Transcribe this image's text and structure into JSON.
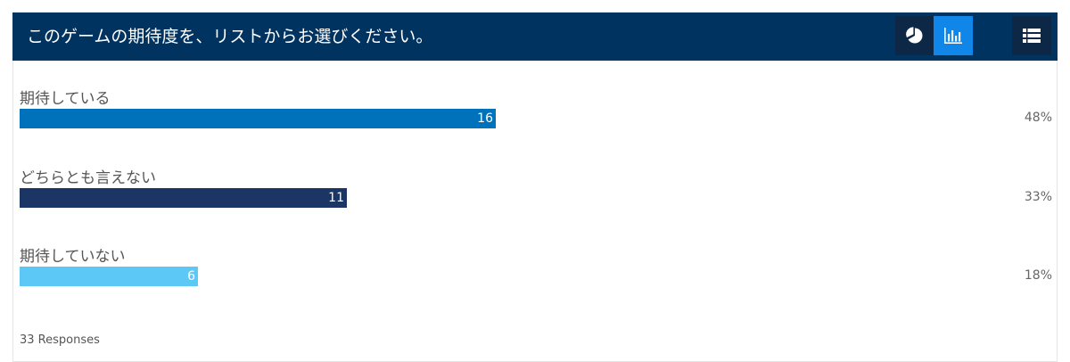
{
  "header": {
    "title": "このゲームの期待度を、リストからお選びください。",
    "background": "#00335f",
    "buttons": [
      {
        "icon": "pie-chart-icon",
        "active": false
      },
      {
        "icon": "bar-chart-icon",
        "active": true
      },
      {
        "icon": "list-view-icon",
        "active": false
      }
    ]
  },
  "chart_data": {
    "type": "bar",
    "orientation": "horizontal",
    "categories": [
      "期待している",
      "どちらとも言えない",
      "期待していない"
    ],
    "values": [
      16,
      11,
      6
    ],
    "value_labels": [
      "16",
      "11",
      "6"
    ],
    "percent_labels": [
      "48%",
      "33%",
      "18%"
    ],
    "colors": [
      "#0072bc",
      "#1b3565",
      "#5bc8f5"
    ],
    "total": 33
  },
  "footer": {
    "responses": "33 Responses"
  }
}
